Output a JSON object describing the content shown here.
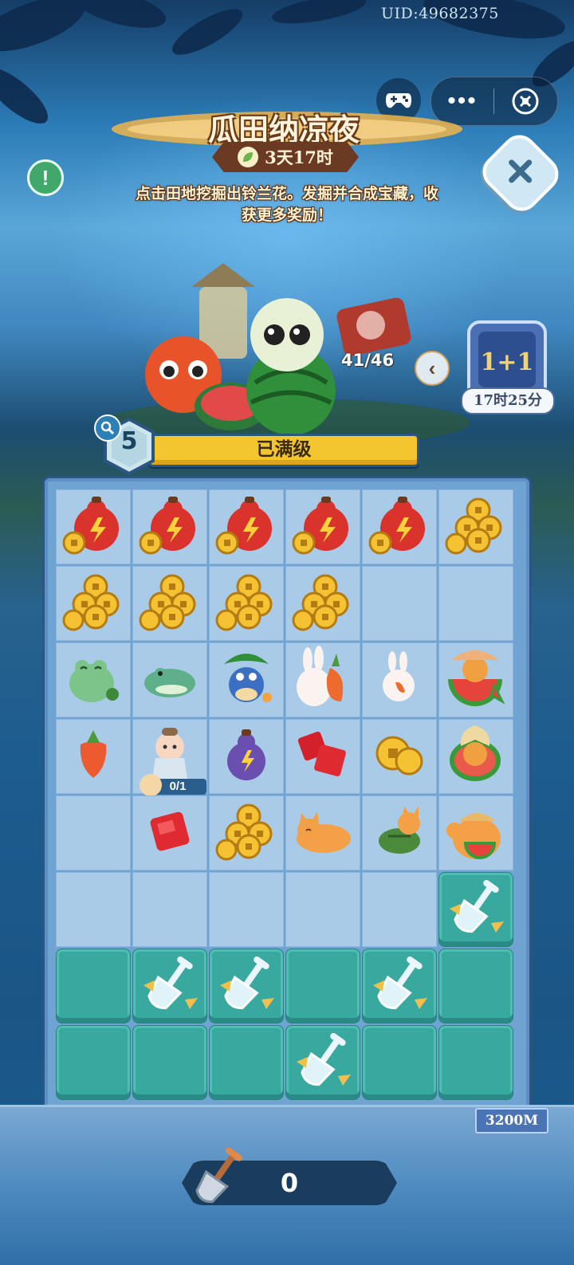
{
  "uid": "UID:49682375",
  "event": {
    "title": "瓜田纳凉夜",
    "timer": "3天17时",
    "description": "点击田地挖掘出铃兰花。发掘并合成宝藏，收获更多奖励！"
  },
  "hero": {
    "collection_count": "41/46"
  },
  "bonus": {
    "label": "1+1",
    "time": "17时25分"
  },
  "level": {
    "number": "5",
    "status": "已满级",
    "progress": 1.0
  },
  "board": {
    "rows": 8,
    "cols": 6,
    "cells": [
      [
        "gourd-energy",
        "gourd-energy",
        "gourd-energy",
        "gourd-energy",
        "gourd-energy",
        "coins-big"
      ],
      [
        "coins-big",
        "coins-big",
        "coins-big",
        "coins-big",
        "empty",
        "empty"
      ],
      [
        "frog-sit",
        "frog-lie",
        "frog-leaf",
        "rabbit-carrot",
        "rabbit-small",
        "watermelon-cat"
      ],
      [
        "carrot",
        "doll",
        "gourd-purple",
        "gems-two",
        "coins-small",
        "melon-cat"
      ],
      [
        "empty",
        "gem-red",
        "coins-big",
        "cat-lie",
        "cat-turtle",
        "cat-watermelon"
      ],
      [
        "empty",
        "empty",
        "empty",
        "empty",
        "empty",
        "soil-shovel"
      ],
      [
        "soil",
        "soil-shovel",
        "soil-shovel",
        "soil",
        "soil-shovel",
        "soil"
      ],
      [
        "soil",
        "soil",
        "soil",
        "soil-shovel",
        "soil",
        "soil"
      ]
    ],
    "doll_progress": "0/1"
  },
  "depth": "3200M",
  "shovels": "0",
  "colors": {
    "soil": "#39a9a0",
    "cell": "#a9cbe8",
    "bar": "#f3c630"
  }
}
